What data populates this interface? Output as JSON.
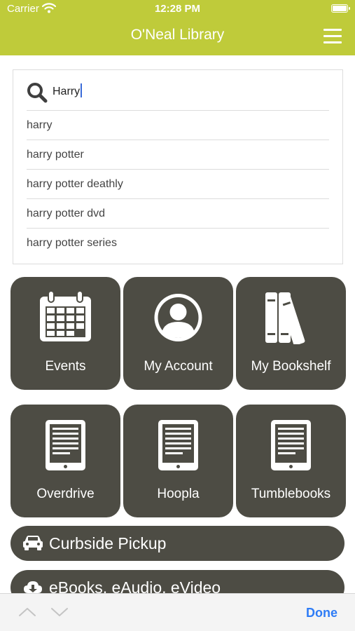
{
  "status_bar": {
    "carrier": "Carrier",
    "time": "12:28 PM"
  },
  "header": {
    "title": "O'Neal Library"
  },
  "search": {
    "value": "Harry",
    "suggestions": [
      "harry",
      "harry potter",
      "harry potter deathly",
      "harry potter dvd",
      "harry potter series"
    ]
  },
  "tiles": [
    {
      "label": "Events",
      "icon": "calendar-icon"
    },
    {
      "label": "My Account",
      "icon": "account-icon"
    },
    {
      "label": "My Bookshelf",
      "icon": "bookshelf-icon"
    },
    {
      "label": "Overdrive",
      "icon": "ereader-icon"
    },
    {
      "label": "Hoopla",
      "icon": "ereader-icon"
    },
    {
      "label": "Tumblebooks",
      "icon": "ereader-icon"
    }
  ],
  "buttons": [
    {
      "label": "Curbside Pickup",
      "icon": "car-icon"
    },
    {
      "label": "eBooks, eAudio, eVideo",
      "icon": "cloud-download-icon"
    }
  ],
  "keyboard_toolbar": {
    "done_label": "Done"
  },
  "colors": {
    "header": "#bfcb3a",
    "tile": "#4d4c44",
    "done": "#2e7cf6"
  }
}
